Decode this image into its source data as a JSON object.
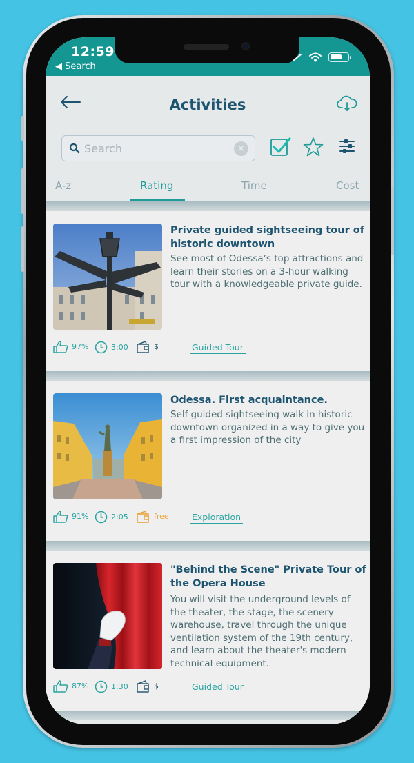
{
  "status_bar": {
    "time": "12:59",
    "back_label": "◀ Search",
    "battery_level": 0.7
  },
  "header": {
    "title": "Activities",
    "back_icon": "arrow-left-icon",
    "download_icon": "cloud-download-icon"
  },
  "search": {
    "placeholder": "Search",
    "value": "",
    "clear_label": "×"
  },
  "toolbar": {
    "icons": [
      "checkbox-checked-icon",
      "star-outline-icon",
      "sliders-icon"
    ]
  },
  "tabs": [
    {
      "label": "A-z",
      "active": false
    },
    {
      "label": "Rating",
      "active": true
    },
    {
      "label": "Time",
      "active": false
    },
    {
      "label": "Cost",
      "active": false
    }
  ],
  "activities": [
    {
      "title": "Private guided sightseeing tour of historic downtown",
      "description": "See most of Odessa’s top attractions and learn their stories on a 3-hour walking tour with a knowledgeable private guide.",
      "rating": "97%",
      "duration": "3:00",
      "cost": "$",
      "cost_color": "#2c5a72",
      "category": "Guided Tour",
      "image": "street-sign-photo"
    },
    {
      "title": "Odessa. First acquaintance.",
      "description": "Self-guided sightseeing walk in historic downtown organized in a way to give you a first impression of the city",
      "rating": "91%",
      "duration": "2:05",
      "cost": "free",
      "cost_color": "#e8a134",
      "category": "Exploration",
      "image": "duke-monument-photo"
    },
    {
      "title": "\"Behind the Scene\" Private Tour of the Opera House",
      "description": "You will visit the underground levels of the theater, the stage, the scenery warehouse, travel through the unique ventilation system of the 19th century, and learn about the theater's modern technical equipment.",
      "rating": "87%",
      "duration": "1:30",
      "cost": "$",
      "cost_color": "#2c5a72",
      "category": "Guided Tour",
      "image": "theater-curtain-photo"
    }
  ],
  "colors": {
    "accent": "#1f9b98",
    "title": "#1d5470",
    "status_bar": "#149693",
    "background": "#45c3e4"
  }
}
